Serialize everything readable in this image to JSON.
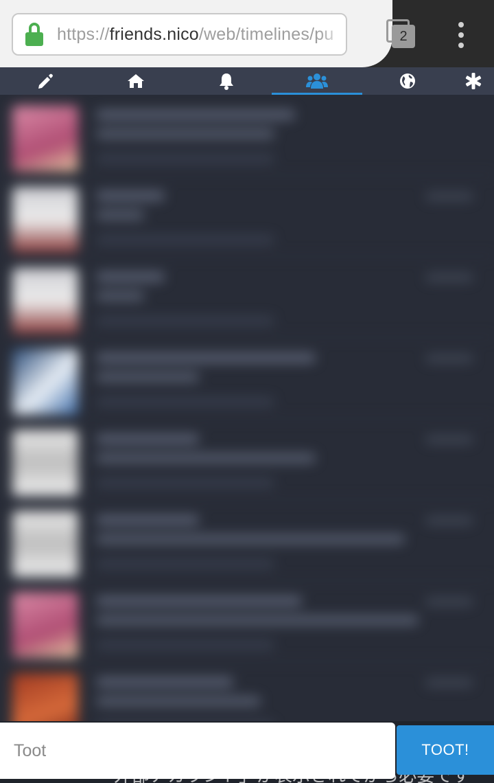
{
  "browser": {
    "url_scheme": "https://",
    "url_host": "friends.nico",
    "url_path": "/web/timelines/pu",
    "tab_count": "2",
    "icons": [
      "lock-icon",
      "tab-switcher-icon",
      "overflow-menu-icon"
    ],
    "secure_color": "#4caf50"
  },
  "nav_tabs": [
    {
      "name": "compose",
      "icon": "pencil-icon",
      "active": false
    },
    {
      "name": "home",
      "icon": "home-icon",
      "active": false
    },
    {
      "name": "notifications",
      "icon": "bell-icon",
      "active": false
    },
    {
      "name": "local",
      "icon": "users-icon",
      "active": true
    },
    {
      "name": "federated",
      "icon": "globe-icon",
      "active": false
    },
    {
      "name": "getting-started",
      "icon": "asterisk-icon",
      "active": false
    }
  ],
  "colors": {
    "accent": "#2b90d9",
    "timeline_bg": "#282c37",
    "tabbar_bg": "#393f4f"
  },
  "compose": {
    "placeholder": "Toot",
    "value": "",
    "submit_label": "TOOT!",
    "partial_underlying_text": "「外部アカウント」が表示されてから必要です"
  }
}
